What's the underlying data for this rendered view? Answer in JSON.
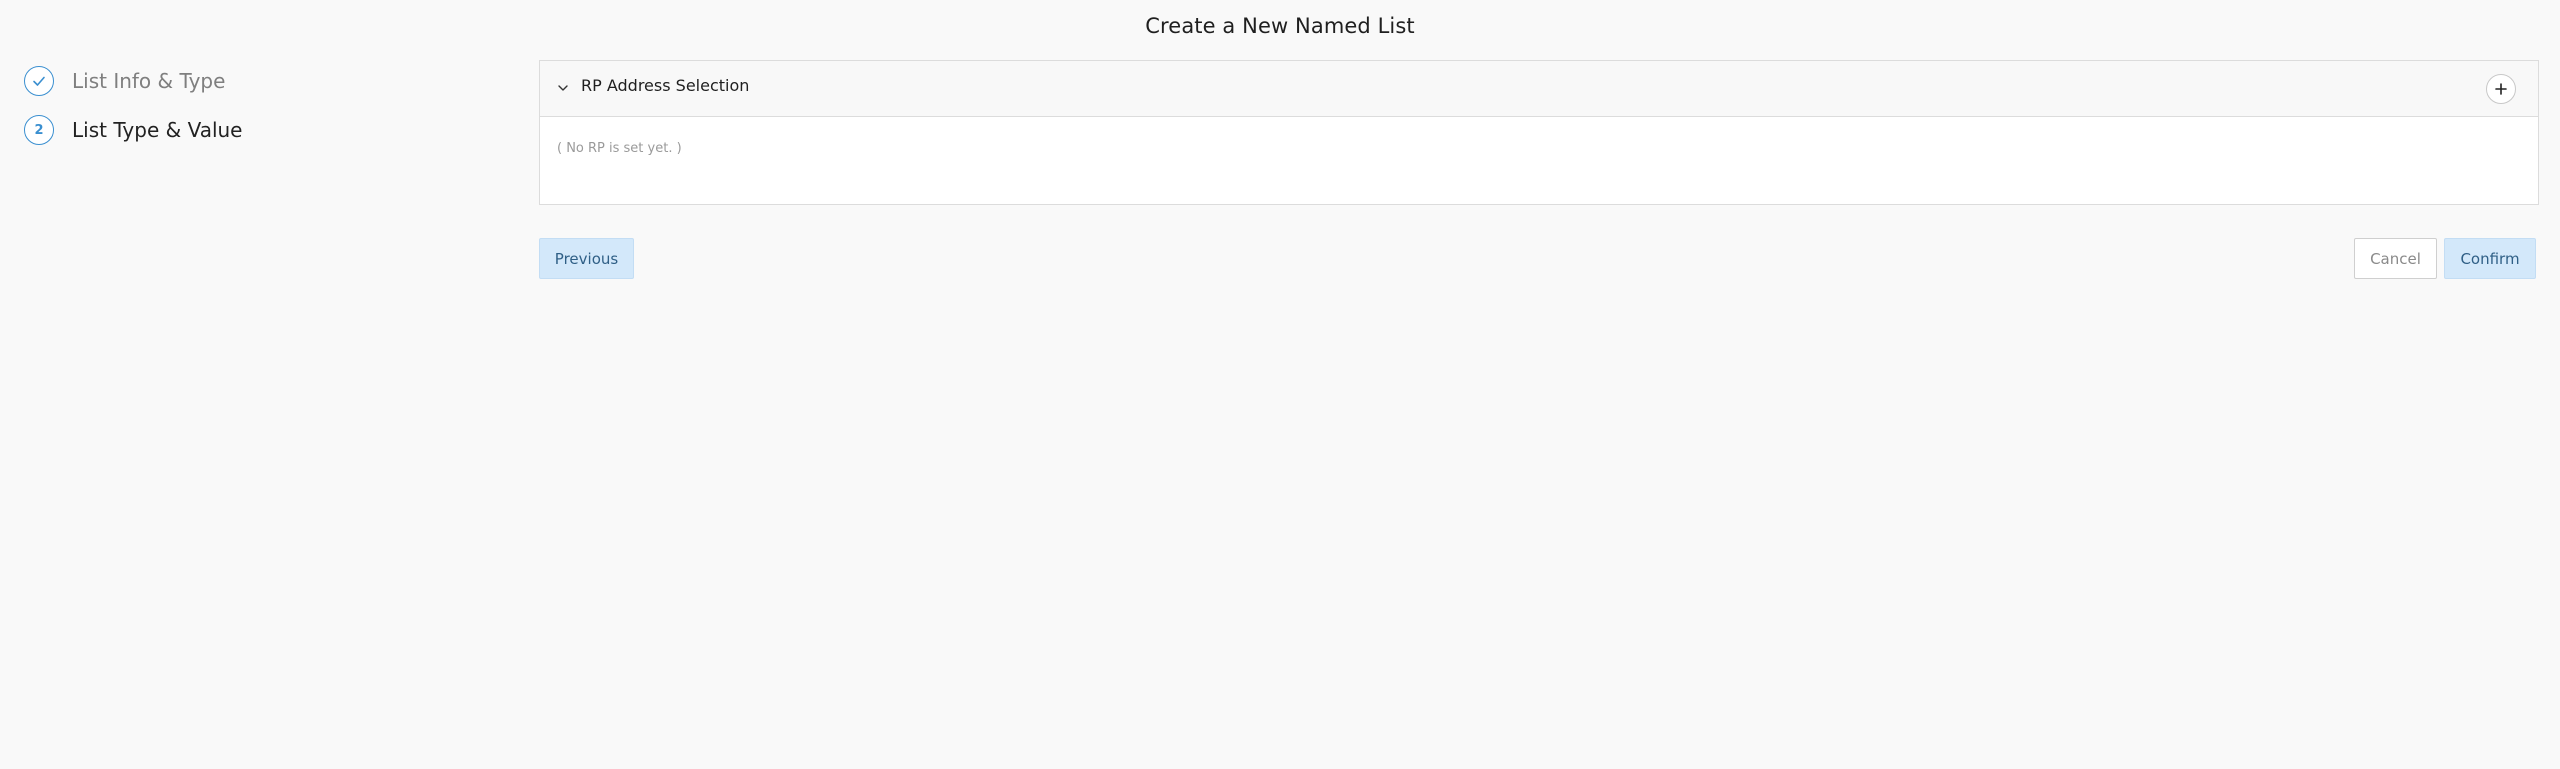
{
  "page": {
    "title": "Create a New Named List"
  },
  "stepper": {
    "steps": [
      {
        "label": "List Info & Type",
        "state": "completed",
        "icon": "check-icon"
      },
      {
        "label": "List Type & Value",
        "state": "active",
        "number": "2"
      }
    ]
  },
  "panel": {
    "title": "RP Address Selection",
    "toggle_icon": "chevron-down-icon",
    "add_icon": "plus-icon",
    "empty_text": "( No RP is set yet. )"
  },
  "actions": {
    "previous_label": "Previous",
    "cancel_label": "Cancel",
    "confirm_label": "Confirm"
  },
  "colors": {
    "accent": "#3a8fd0",
    "primary_button_bg": "#d3e8fa",
    "page_bg": "#f9f9f9"
  }
}
